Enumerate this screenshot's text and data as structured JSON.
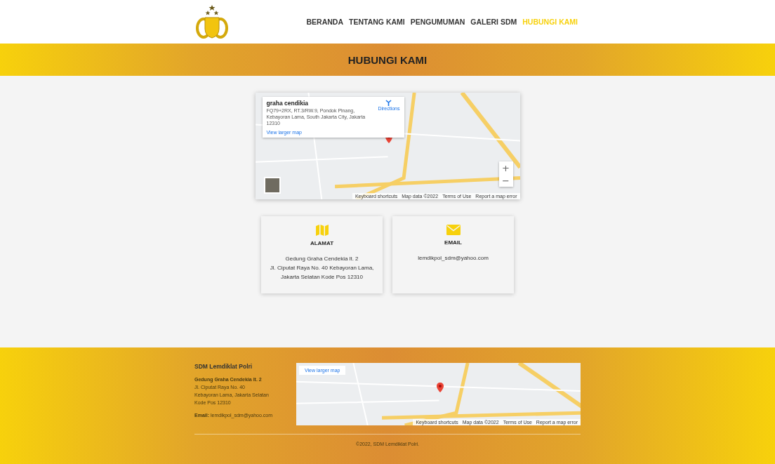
{
  "nav": [
    {
      "label": "BERANDA",
      "selected": false
    },
    {
      "label": "TENTANG KAMI",
      "selected": false
    },
    {
      "label": "PENGUMUMAN",
      "selected": false
    },
    {
      "label": "GALERI SDM",
      "selected": false
    },
    {
      "label": "HUBUNGI KAMI",
      "selected": true
    }
  ],
  "banner": {
    "title": "HUBUNGI KAMI"
  },
  "map": {
    "place": "graha cendikia",
    "address": "FQ79+2RX, RT.3/RW.9, Pondok Pinang, Kebayoran Lama, South Jakarta City, Jakarta 12310",
    "directions": "Directions",
    "larger": "View larger map",
    "zoom_in": "+",
    "zoom_out": "−",
    "attribution": [
      "Keyboard shortcuts",
      "Map data ©2022",
      "Terms of Use",
      "Report a map error"
    ]
  },
  "cards": [
    {
      "kind": "map",
      "title": "ALAMAT",
      "lines": [
        "Gedung Graha Cendekia lt. 2",
        "Jl. Ciputat Raya No. 40 Kebayoran Lama,",
        "Jakarta Selatan Kode Pos 12310"
      ]
    },
    {
      "kind": "mail",
      "title": "EMAIL",
      "lines": [
        "lemdikpol_sdm@yahoo.com"
      ]
    }
  ],
  "footer": {
    "title": "SDM Lemdiklat Polri",
    "address": "**Gedung Graha Cendekia lt. 2**",
    "address_lines": [
      "Jl. Ciputat Raya No. 40",
      "Kebayoran Lama, Jakarta Selatan",
      "Kode Pos 12310"
    ],
    "email": "**Email:** lemdikpol_sdm@yahoo.com",
    "map": {
      "larger": "View larger map",
      "attribution": [
        "Keyboard shortcuts",
        "Map data ©2022",
        "Terms of Use",
        "Report a map error"
      ]
    },
    "copyright": "©2022, SDM Lemdiklat Polri."
  }
}
